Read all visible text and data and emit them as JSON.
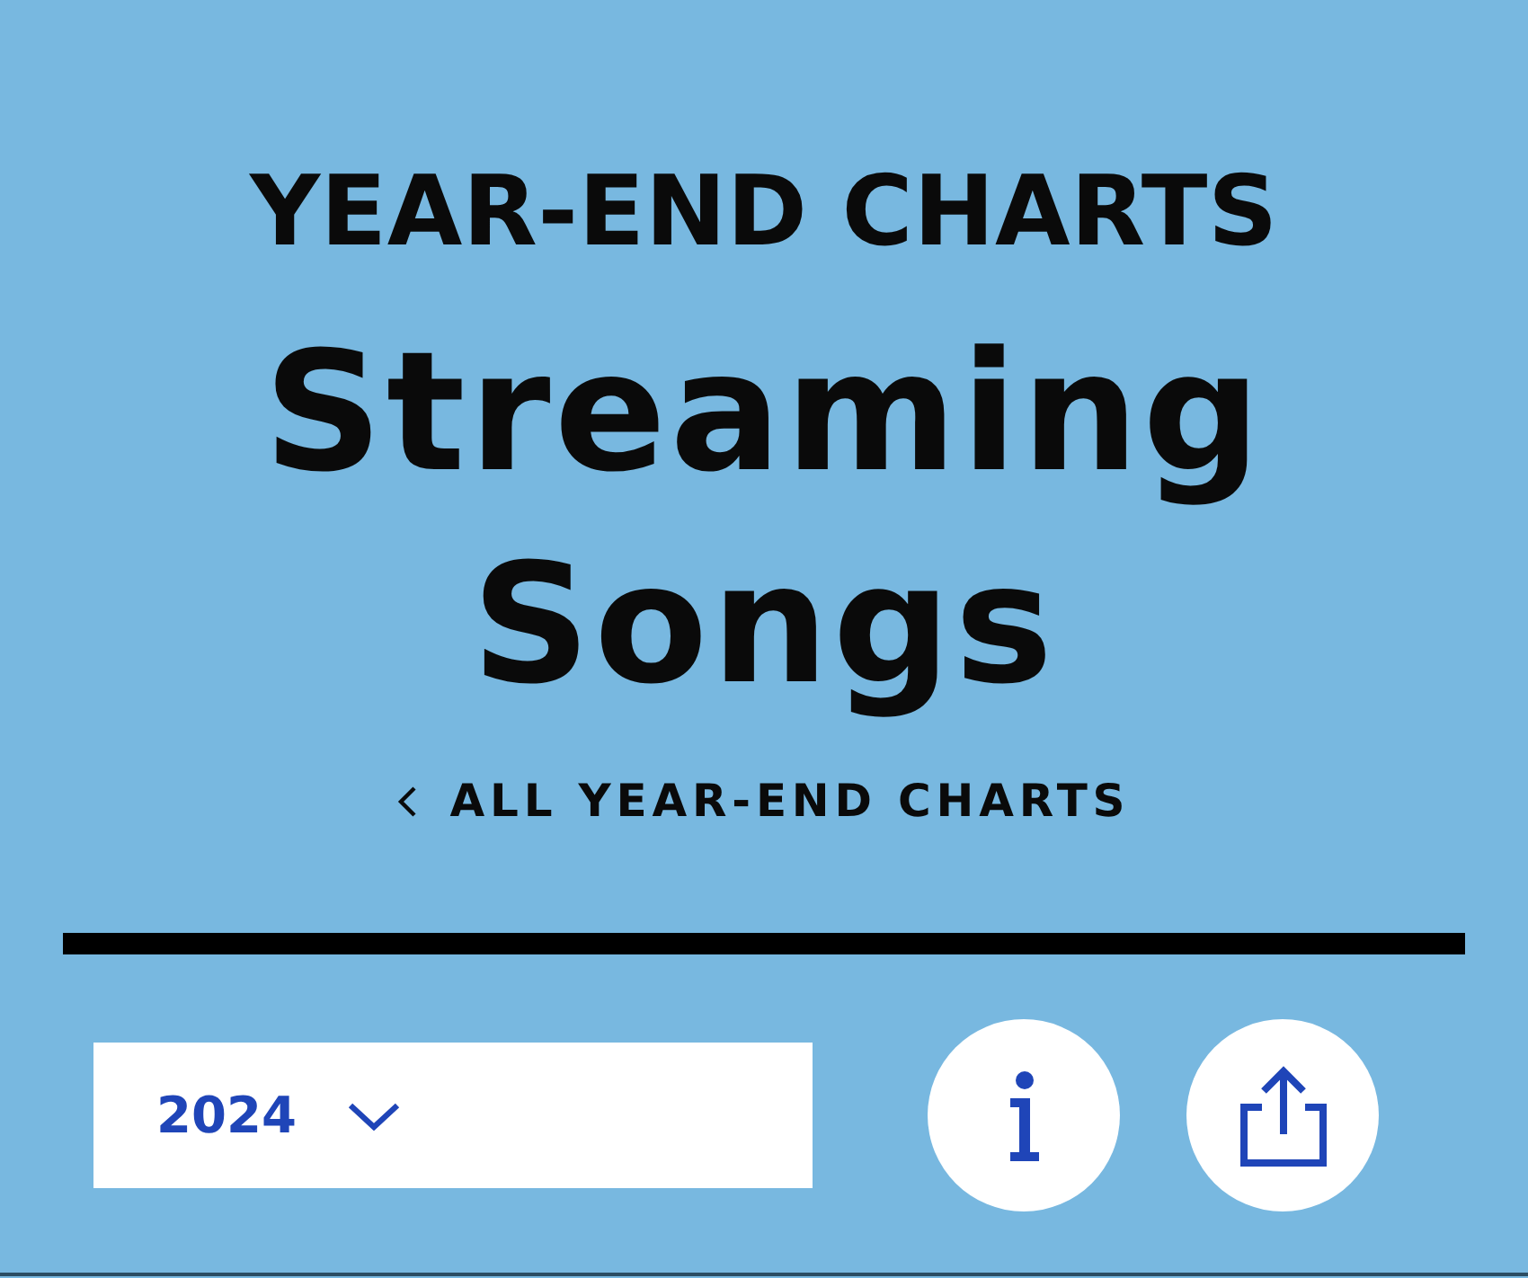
{
  "header": {
    "eyebrow": "YEAR-END CHARTS",
    "title": "Streaming Songs"
  },
  "back_link": {
    "label": "ALL YEAR-END CHARTS"
  },
  "controls": {
    "year_select": {
      "value": "2024"
    },
    "buttons": [
      {
        "kind": "info"
      },
      {
        "kind": "share"
      }
    ]
  }
}
